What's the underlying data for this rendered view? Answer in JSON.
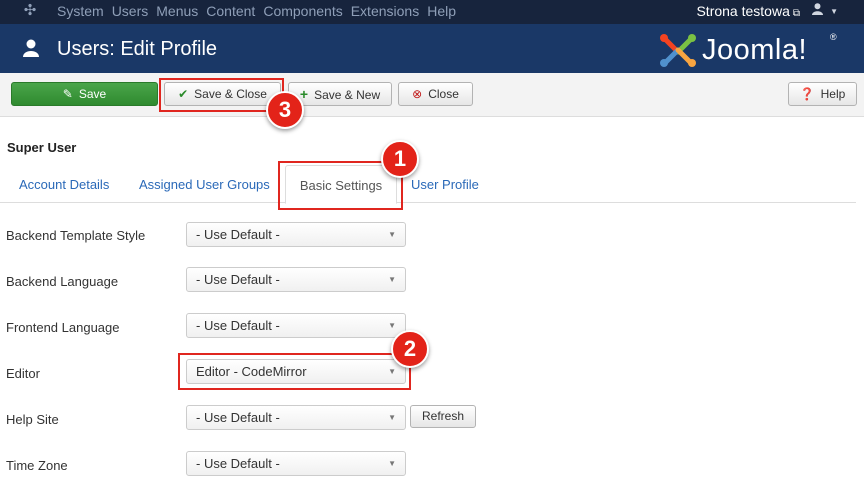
{
  "topbar": {
    "menu": [
      "System",
      "Users",
      "Menus",
      "Content",
      "Components",
      "Extensions",
      "Help"
    ],
    "site_link": "Strona testowa"
  },
  "header": {
    "title": "Users: Edit Profile",
    "brand": "Joomla!"
  },
  "toolbar": {
    "save_label": "Save",
    "save_close_label": "Save & Close",
    "save_new_label": "Save & New",
    "close_label": "Close",
    "help_label": "Help"
  },
  "content": {
    "user_name": "Super User",
    "tabs": [
      "Account Details",
      "Assigned User Groups",
      "Basic Settings",
      "User Profile"
    ],
    "active_tab": "Basic Settings",
    "fields": [
      {
        "label": "Backend Template Style",
        "value": "- Use Default -"
      },
      {
        "label": "Backend Language",
        "value": "- Use Default -"
      },
      {
        "label": "Frontend Language",
        "value": "- Use Default -"
      },
      {
        "label": "Editor",
        "value": "Editor - CodeMirror"
      },
      {
        "label": "Help Site",
        "value": "- Use Default -"
      },
      {
        "label": "Time Zone",
        "value": "- Use Default -"
      }
    ],
    "refresh_label": "Refresh"
  },
  "annotations": {
    "badges": [
      "1",
      "2",
      "3"
    ],
    "color": "#e32319"
  },
  "colors": {
    "topbar": "#17243d",
    "header": "#1a3867",
    "save_button": "#3a983a",
    "link": "#2a69b8"
  }
}
